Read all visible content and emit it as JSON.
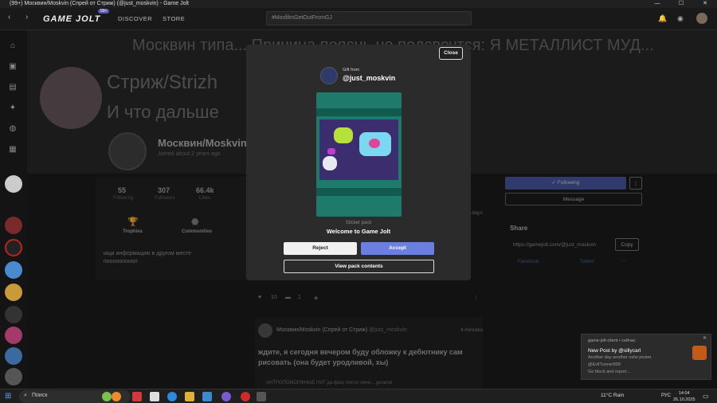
{
  "window": {
    "title": "(99+) Москвин/Moskvin (Спрей от Стриж) (@just_moskvin) - Game Jolt"
  },
  "nav": {
    "logo": "GAME JOLT",
    "badge": "99+",
    "discover": "DISCOVER",
    "store": "STORE",
    "search_placeholder": "#MosfilmGetOutFromGJ"
  },
  "banner": {
    "headline": "Москвин типа... Причина пояснь не подсвечтся: Я МЕТАЛЛИСТ МУД...",
    "strizh": "Стриж/Strizh",
    "subtext": "И что дальше"
  },
  "profile": {
    "name": "Москвин/Moskvin",
    "joined": "Joined about 2 years ago",
    "stats": [
      {
        "num": "55",
        "label": "Following"
      },
      {
        "num": "307",
        "label": "Followers"
      },
      {
        "num": "66.4k",
        "label": "Likes"
      }
    ],
    "trophies": "Trophies",
    "communities": "Communities",
    "bio_line1": "ищи информацию в другом месте",
    "bio_line2": "пооооооооол"
  },
  "right": {
    "following": "Following",
    "message": "Message",
    "share": "Share",
    "link": "https://gamejolt.com/@just_moskvin",
    "copy": "Copy",
    "facebook": "Facebook",
    "twitter": "Twitter"
  },
  "feed": {
    "days": "days",
    "likes": "10",
    "comments": "1",
    "author": "Москвин/Moskvin (Спрей от Стриж)",
    "handle": "@just_moskvin",
    "time": "4 minutes",
    "text": "ждите, я сегодня вечером буду обложку к дебютнику сам рисовать (она будет уродливой, хы)",
    "tag": "АНТРОПОМОРФНЫЕ НАТ да фокс horror личн...",
    "tag2": "general"
  },
  "modal": {
    "close": "Close",
    "gift_from": "Gift from",
    "user": "@just_moskvin",
    "pack_type": "Sticker pack",
    "pack_name": "Welcome to Game Jolt",
    "reject": "Reject",
    "accept": "Accept",
    "view": "View pack contents"
  },
  "toast": {
    "app": "game-jolt-client • сейчас",
    "title": "New Post by @sillycarl",
    "line1": "Another day another nsfw poster",
    "line2": "@EvilTunner999",
    "line3": "Go block and report..."
  },
  "taskbar": {
    "search": "Поиск",
    "weather": "11°C Rain",
    "lang": "РУС",
    "time": "14:04",
    "date": "26.10.2025"
  },
  "colors": {
    "accent": "#6a7fe0",
    "pack": "#1e7a6a"
  }
}
